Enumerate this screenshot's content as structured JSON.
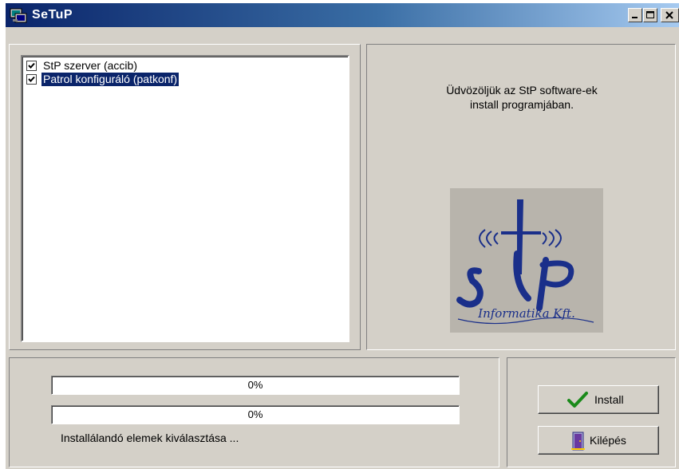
{
  "window": {
    "title": "SeTuP",
    "controls": [
      "minimize-icon",
      "maximize-icon",
      "close-icon"
    ]
  },
  "packages": {
    "items": [
      {
        "label": "StP szerver (accib)",
        "checked": true,
        "selected": false
      },
      {
        "label": "Patrol konfiguráló (patkonf)",
        "checked": true,
        "selected": true
      }
    ]
  },
  "welcome": {
    "line1": "Üdvözöljük az StP software-ek",
    "line2": "install programjában."
  },
  "logo": {
    "mark": "StP",
    "tagline": "Informatika Kft.",
    "colors": {
      "background": "#b8b4ac",
      "ink": "#1a2f8a"
    }
  },
  "progress": {
    "bar1": {
      "value": 0,
      "label": "0%"
    },
    "bar2": {
      "value": 0,
      "label": "0%"
    },
    "status_text": "Installálandó elemek kiválasztása ..."
  },
  "buttons": {
    "install": {
      "label": "Install",
      "icon": "checkmark-icon"
    },
    "exit": {
      "label": "Kilépés",
      "icon": "exit-door-icon"
    }
  },
  "colors": {
    "titlebar_start": "#0a246a",
    "titlebar_end": "#a6caf0",
    "face": "#d4d0c8",
    "selection": "#0a246a",
    "check_green": "#1a8a1a"
  }
}
